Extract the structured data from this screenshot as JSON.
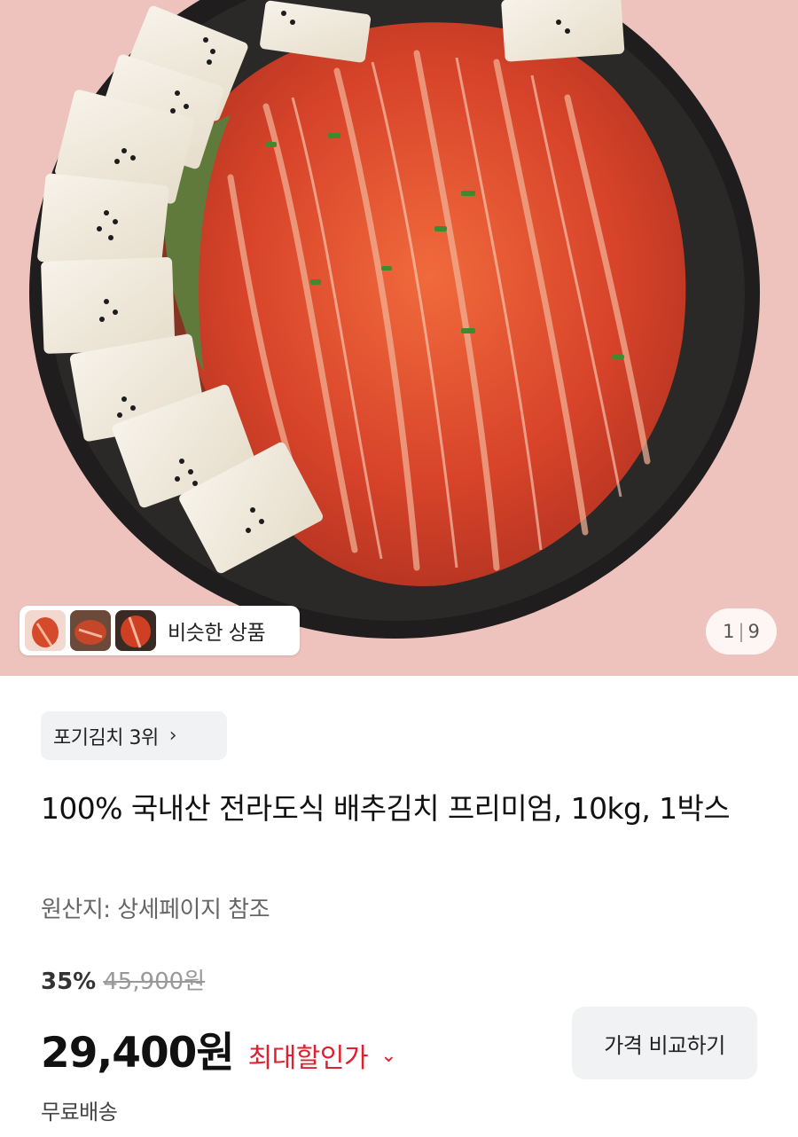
{
  "gallery": {
    "similar_products_label": "비슷한 상품",
    "current_index": "1",
    "total": "9"
  },
  "product": {
    "category_rank": "포기김치 3위",
    "title": "100% 국내산 전라도식 배추김치 프리미엄, 10kg, 1박스",
    "origin": "원산지: 상세페이지 참조",
    "discount_rate": "35%",
    "original_price": "45,900원",
    "sale_price": "29,400원",
    "max_discount_label": "최대할인가",
    "compare_button": "가격 비교하기",
    "shipping": "무료배송"
  },
  "colors": {
    "accent_red": "#e0202f",
    "background_pink": "#efc3bd",
    "chip_gray": "#f1f2f4"
  },
  "icons": {
    "rank_chevron": "chevron-right-icon",
    "discount_chevron": "chevron-down-icon"
  }
}
